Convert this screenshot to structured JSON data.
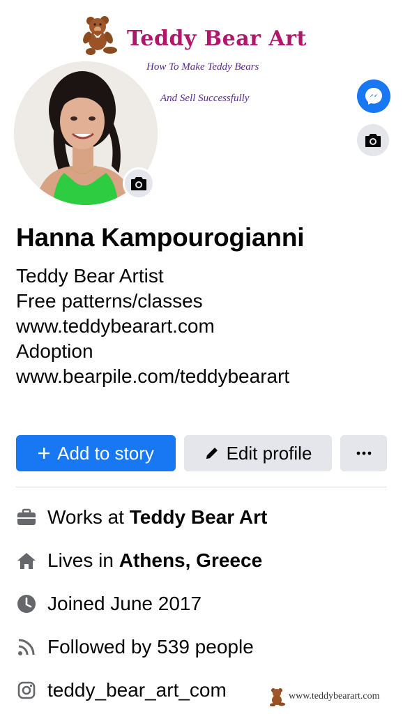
{
  "logo": {
    "title": "Teddy Bear Art",
    "subtitle_line1": "How To Make Teddy Bears",
    "subtitle_line2": "And Sell Successfully"
  },
  "profile": {
    "name": "Hanna Kampourogianni",
    "bio": [
      "Teddy Bear Artist",
      "Free patterns/classes",
      "www.teddybearart.com",
      "Adoption",
      "www.bearpile.com/teddybearart"
    ]
  },
  "actions": {
    "add_story_label": "Add to story",
    "edit_profile_label": "Edit profile"
  },
  "details": {
    "work_prefix": "Works at",
    "work_place": "Teddy Bear Art",
    "lives_prefix": "Lives in",
    "lives_place": "Athens, Greece",
    "joined": "Joined June 2017",
    "followers": "Followed by 539 people",
    "instagram": "teddy_bear_art_com"
  },
  "watermark": {
    "text": "www.teddybearart.com"
  },
  "colors": {
    "primary": "#1877f2",
    "secondary_button": "#e4e6eb",
    "logo_title": "#b0176b",
    "logo_subtitle": "#5a2b8f",
    "icon_gray": "#65676b"
  },
  "icons": {
    "messenger": "messenger-icon",
    "camera": "camera-icon",
    "plus": "plus-icon",
    "pencil": "pencil-icon",
    "more": "ellipsis-icon",
    "work": "briefcase-icon",
    "home": "home-icon",
    "joined": "clock-icon",
    "followers": "rss-icon",
    "instagram": "instagram-icon"
  }
}
